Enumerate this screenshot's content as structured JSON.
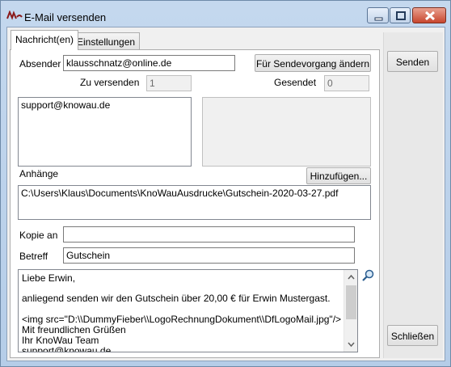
{
  "window": {
    "title": "E-Mail versenden"
  },
  "tabs": [
    {
      "label": "Nachricht(en)"
    },
    {
      "label": "Einstellungen"
    }
  ],
  "form": {
    "absender_label": "Absender",
    "absender_value": "klausschnatz@online.de",
    "change_send_button": "Für Sendevorgang ändern",
    "zu_versenden_label": "Zu versenden",
    "zu_versenden_value": "1",
    "gesendet_label": "Gesendet",
    "gesendet_value": "0",
    "recipients": [
      "support@knowau.de"
    ],
    "anhaenge_label": "Anhänge",
    "add_attachment_button": "Hinzufügen...",
    "attachments": [
      "C:\\Users\\Klaus\\Documents\\KnoWauAusdrucke\\Gutschein-2020-03-27.pdf"
    ],
    "kopie_label": "Kopie an",
    "kopie_value": "",
    "betreff_label": "Betreff",
    "betreff_value": "Gutschein",
    "body_lines": [
      "Liebe Erwin,",
      "",
      "anliegend senden wir den Gutschein über 20,00 € für Erwin Mustergast.",
      "",
      "<img src=\"D:\\\\DummyFieber\\\\LogoRechnungDokument\\\\DfLogoMail.jpg\"/>",
      "Mit freundlichen Grüßen",
      "Ihr KnoWau Team",
      "support@knowau.de"
    ]
  },
  "side": {
    "send_button": "Senden",
    "close_button": "Schließen"
  }
}
